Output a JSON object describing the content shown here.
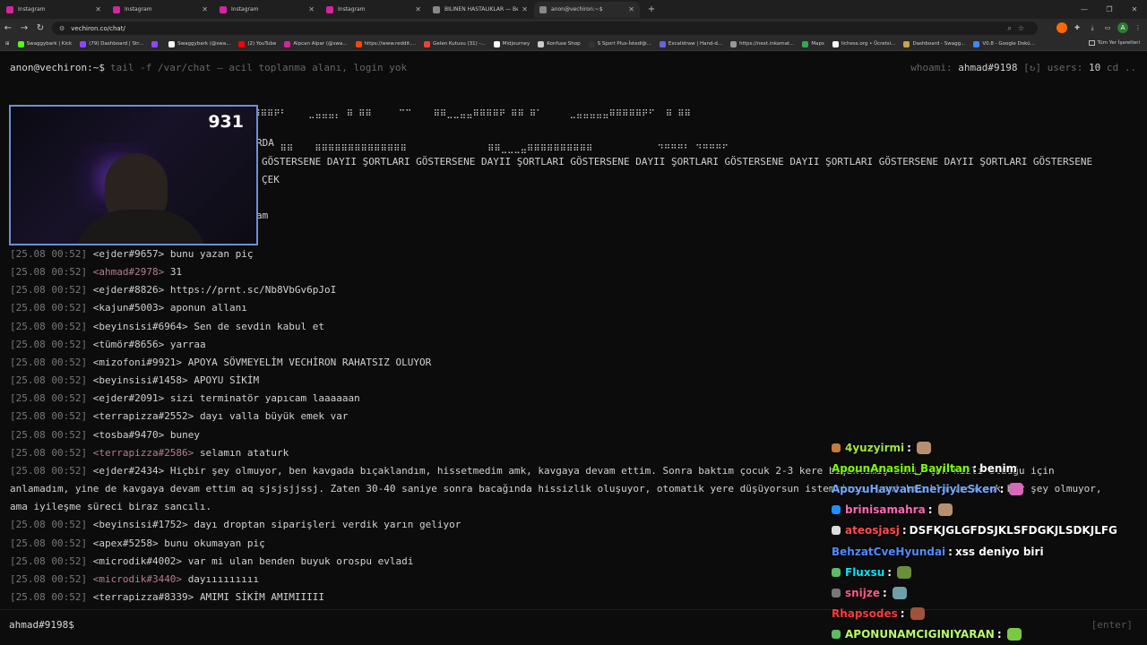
{
  "browser": {
    "tabs": [
      {
        "title": "Instagram",
        "color": "#d6249f",
        "active": false
      },
      {
        "title": "Instagram",
        "color": "#d6249f",
        "active": false
      },
      {
        "title": "Instagram",
        "color": "#d6249f",
        "active": false
      },
      {
        "title": "Instagram",
        "color": "#d6249f",
        "active": false
      },
      {
        "title": "BİLİNEN HASTALIKLAR — Bede",
        "color": "#888888",
        "active": false
      },
      {
        "title": "anon@vechiron:~$",
        "color": "#888888",
        "active": true
      }
    ],
    "url": "vechiron.co/chat/",
    "bookmarks": [
      {
        "label": "Swaggybark | Kick",
        "color": "#53fc18"
      },
      {
        "label": "(79) Dashboard | Str...",
        "color": "#9146ff"
      },
      {
        "label": "",
        "color": "#9146ff"
      },
      {
        "label": "Swaggybark (@swa...",
        "color": "#ffffff"
      },
      {
        "label": "(2) YouTube",
        "color": "#ff0000"
      },
      {
        "label": "Alpcan Alpar (@swa...",
        "color": "#d6249f"
      },
      {
        "label": "https://www.reddit....",
        "color": "#ff4500"
      },
      {
        "label": "Gelen Kutusu (31) -...",
        "color": "#ea4335"
      },
      {
        "label": "Midjourney",
        "color": "#ffffff"
      },
      {
        "label": "Konfuse Shop",
        "color": "#cccccc"
      },
      {
        "label": "S Sport Plus-İstediği...",
        "color": "#333333"
      },
      {
        "label": "Excalidraw | Hand-d...",
        "color": "#6965db"
      },
      {
        "label": "https://next.inkamat...",
        "color": "#999999"
      },
      {
        "label": "Maps",
        "color": "#34a853"
      },
      {
        "label": "lichess.org • Ücretsi...",
        "color": "#ffffff"
      },
      {
        "label": "Dashboard - Swagg...",
        "color": "#c9a34a"
      },
      {
        "label": "V0.8 - Google Dokü...",
        "color": "#4285f4"
      }
    ],
    "all_bookmarks": "Tüm Yer İşaretleri"
  },
  "terminal": {
    "prompt": "anon@vechiron:~$",
    "command": "tail -f /var/chat — acil toplanma alanı, login yok",
    "whoami_label": "whoami:",
    "whoami_value": "ahmad#9198",
    "refresh": "[↻]",
    "users_label": "users:",
    "users_value": "10",
    "cd": "cd ..",
    "ascii_lines": [
      "⠿⠛⠻⠃  ⠿⠿⠿⣄⣀⣀⣀⣀⣀⠿⠇      ⣀   ⣠⠇ ⣠⠇   ⠻⠿⠿⠿⠿⠿⠿⠿⠟⠃    ⣀⣤⣤⣤⡄ ⠿ ⠿⠿     ⠉⠉    ⠿⠿⣀⣀⣤⣤⠿⠿⠿⠿⠟ ⠿⠿ ⠿⠁     ⣀⣤⣤⣤⣤⣤⠿⠿⠿⠿⠿⠟⠋  ⠿ ⠿⠿",
      "                 ⠿     ⠿⠿⠿⠿⠿⠿⠿⠿⠿⠿⠿⠿⠟⠃          ⠿⠿    ⠿⠿⠿⠿⠿⠿⠿⠿⠿⠿⠿⠿⠿⠿               ⠿⠿⣀⣀⣀⣤⠿⠿⠿⠿⠿⠿⠿⠿⠿⠿            ⠙⠛⠛⠛⠃ ⠙⠛⠛⠛⠋"
    ],
    "system_lines": [
      "RDA",
      "GÖSTERSENE DAYII ŞORTLARI GÖSTERSENE DAYII ŞORTLARI GÖSTERSENE DAYII ŞORTLARI GÖSTERSENE DAYII ŞORTLARI GÖSTERSENE DAYII ŞORTLARI GÖSTERSENE",
      "ÇEK",
      "am"
    ],
    "messages": [
      {
        "ts": "[25.08 00:52]",
        "nick": "<ejder#9657>",
        "text": "bunu yazan piç"
      },
      {
        "ts": "[25.08 00:52]",
        "nick": "<ahmad#2978>",
        "text": "31",
        "hl": true
      },
      {
        "ts": "[25.08 00:52]",
        "nick": "<ejder#8826>",
        "text": "https://prnt.sc/Nb8VbGv6pJoI"
      },
      {
        "ts": "[25.08 00:52]",
        "nick": "<kajun#5003>",
        "text": "aponun allanı"
      },
      {
        "ts": "[25.08 00:52]",
        "nick": "<beyinsisi#6964>",
        "text": "Sen de sevdin kabul et"
      },
      {
        "ts": "[25.08 00:52]",
        "nick": "<tümör#8656>",
        "text": "yarraa"
      },
      {
        "ts": "[25.08 00:52]",
        "nick": "<mizofoni#9921>",
        "text": "APOYA SÖVMEYELİM VECHİRON RAHATSIZ OLUYOR"
      },
      {
        "ts": "[25.08 00:52]",
        "nick": "<beyinsisi#1458>",
        "text": "APOYU SİKİM"
      },
      {
        "ts": "[25.08 00:52]",
        "nick": "<ejder#2091>",
        "text": "sizi terminatör yapıcam laaaaaan"
      },
      {
        "ts": "[25.08 00:52]",
        "nick": "<terrapizza#2552>",
        "text": "dayı valla büyük emek var"
      },
      {
        "ts": "[25.08 00:52]",
        "nick": "<tosba#9470>",
        "text": "buney"
      },
      {
        "ts": "[25.08 00:52]",
        "nick": "<terrapizza#2586>",
        "text": "selamın ataturk",
        "hl": true
      },
      {
        "ts": "[25.08 00:52]",
        "nick": "<ejder#2434>",
        "text": "Hiçbir şey olmuyor, ben kavgada bıçaklandım, hissetmedim amk, kavgaya devam ettim. Sonra baktım çocuk 2-3 kere bıçaklamış beni, çok hızlı olduğu için anlamadım, yine de kavgaya devam ettim aq sjsjsjjssj. Zaten 30-40 saniye sonra bacağında hissizlik oluşuyor, otomatik yere düşüyorsun istemsizce, yani bıçaklanınca çok bir şey olmuyor, ama iyileşme süreci biraz sancılı."
      },
      {
        "ts": "[25.08 00:52]",
        "nick": "<beyinsisi#1752>",
        "text": "dayı droptan siparişleri verdik yarın geliyor"
      },
      {
        "ts": "[25.08 00:52]",
        "nick": "<apex#5258>",
        "text": "bunu okumayan piç"
      },
      {
        "ts": "[25.08 00:52]",
        "nick": "<microdik#4002>",
        "text": "var mi ulan benden buyuk orospu evladi"
      },
      {
        "ts": "[25.08 00:52]",
        "nick": "<microdik#3440>",
        "text": "dayııııııııı",
        "hl": true
      },
      {
        "ts": "[25.08 00:52]",
        "nick": "<terrapizza#8339>",
        "text": "AMIMI SİKİM AMIMIIIII"
      }
    ],
    "input_prompt": "ahmad#9198$",
    "enter_hint": "[enter]"
  },
  "webcam": {
    "counter": "931"
  },
  "stream_chat": [
    {
      "user": "4yuzyirmi",
      "color": "#a3e635",
      "badge": "#c77b3b",
      "text": "",
      "emote": "#b89070"
    },
    {
      "user": "ApounAnasini_Bayiltan",
      "color": "#7cfc00",
      "badge": "",
      "text": "benim",
      "emote": ""
    },
    {
      "user": "ApoyuHayvanEnerjiyleSken",
      "color": "#6fa8ff",
      "badge": "",
      "text": "",
      "emote": "#d46ab8"
    },
    {
      "user": "brinisamahra",
      "color": "#ff69b4",
      "badge": "#1e90ff",
      "text": "",
      "emote": "#b89070"
    },
    {
      "user": "ateosjasj",
      "color": "#ff4d4d",
      "badge": "#dddddd",
      "text": "DSFKJGLGFDSJKLSFDGKJLSDKJLFG",
      "emote": ""
    },
    {
      "user": "BehzatCveHyundai",
      "color": "#4f8cff",
      "badge": "",
      "text": "xss deniyo biri",
      "emote": ""
    },
    {
      "user": "Fluxsu",
      "color": "#00e5ff",
      "badge": "#5dbb63",
      "text": "",
      "emote": "#6a8f3a"
    },
    {
      "user": "snijze",
      "color": "#ff5a8a",
      "badge": "#777777",
      "text": "",
      "emote": "#6fa0a8"
    },
    {
      "user": "Rhapsodes",
      "color": "#ff3b3b",
      "badge": "",
      "text": "",
      "emote": "#a0523a"
    },
    {
      "user": "APONUNAMCIGINIYARAN",
      "color": "#b8ff6a",
      "badge": "#5dbb63",
      "text": "",
      "emote": "#7ac943"
    }
  ]
}
